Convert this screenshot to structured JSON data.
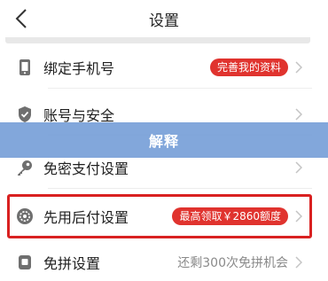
{
  "header": {
    "title": "设置",
    "back_icon": "chevron-left-icon"
  },
  "settings": {
    "items": [
      {
        "label": "绑定手机号",
        "icon": "phone-icon",
        "badge": "完善我的资料"
      },
      {
        "label": "账号与安全",
        "icon": "shield-check-icon"
      },
      {
        "label": "免密支付设置",
        "icon": "key-icon"
      },
      {
        "label": "先用后付设置",
        "icon": "gear-icon",
        "badge": "最高领取￥2860额度"
      },
      {
        "label": "免拼设置",
        "icon": "coupon-icon",
        "hint": "还剩300次免拼机会"
      }
    ]
  },
  "overlay": {
    "banner_text": "解释"
  },
  "colors": {
    "accent_red": "#e0332e",
    "highlight_border": "#d92121",
    "banner_blue": "#719bd6",
    "icon_gray": "#6f6f6f"
  }
}
